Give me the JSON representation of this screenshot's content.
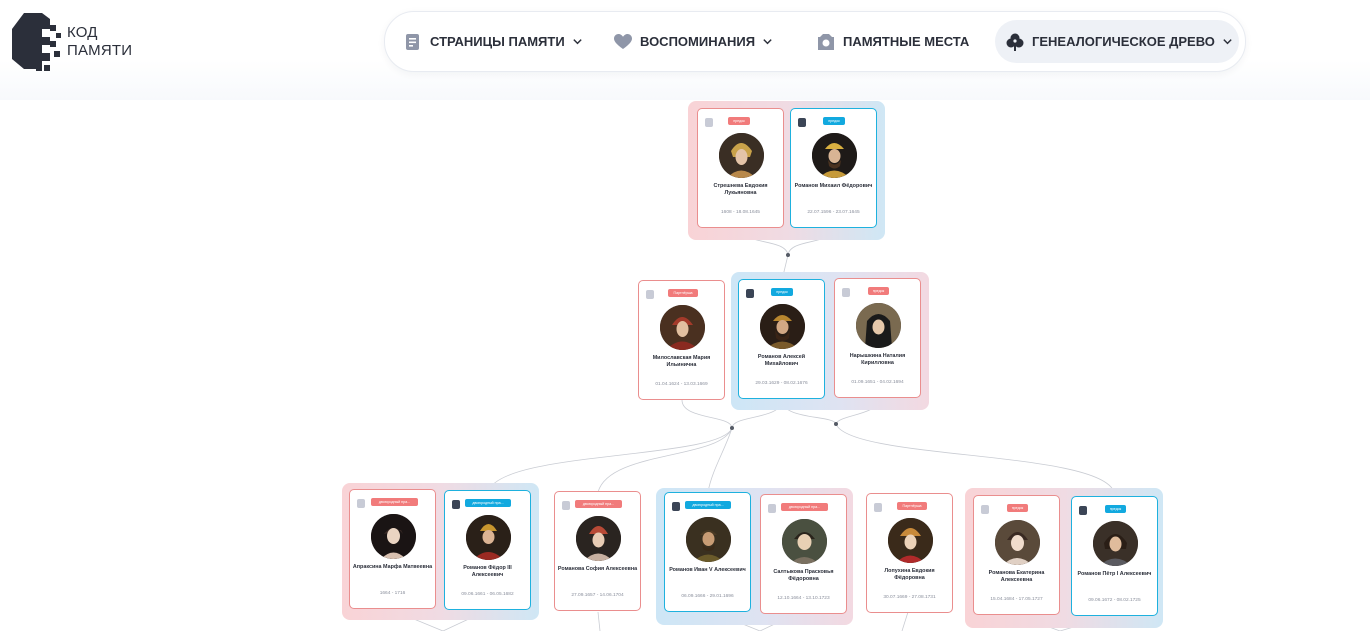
{
  "header": {
    "logo_line1": "КОД",
    "logo_line2": "ПАМЯТИ",
    "nav": [
      {
        "label": "СТРАНИЦЫ ПАМЯТИ",
        "icon": "document-icon",
        "dropdown": true
      },
      {
        "label": "ВОСПОМИНАНИЯ",
        "icon": "heart-icon",
        "dropdown": true
      },
      {
        "label": "ПАМЯТНЫЕ МЕСТА",
        "icon": "camera-icon",
        "dropdown": false
      },
      {
        "label": "ГЕНЕАЛОГИЧЕСКОЕ ДРЕВО",
        "icon": "tree-icon",
        "dropdown": true,
        "active": true
      }
    ]
  },
  "colors": {
    "female_border": "#ea8e8e",
    "male_border": "#1eb1de",
    "female_tag": "#f17b7b",
    "male_tag": "#12a9df"
  },
  "people": {
    "streshneva": {
      "tag": "предок",
      "name": "Стрешнева Евдокия Лукьяновна",
      "dates": "1608 - 18.08.1645"
    },
    "mikhail": {
      "tag": "предок",
      "name": "Романов Михаил Фёдорович",
      "dates": "22.07.1596 - 23.07.1645"
    },
    "miloslavskaya": {
      "tag": "Партнёрша",
      "name": "Милославская Мария Ильинична",
      "dates": "01.04.1624 - 13.03.1669"
    },
    "aleksey": {
      "tag": "предок",
      "name": "Романов Алексей Михайлович",
      "dates": "29.03.1629 - 08.02.1676"
    },
    "naryshkina": {
      "tag": "предок",
      "name": "Нарышкина Наталия Кирилловна",
      "dates": "01.09.1651 - 04.02.1694"
    },
    "apraksina": {
      "tag": "двоюродный пра...",
      "name": "Апраксина Марфа Матвеевна",
      "dates": "1664 - 1716"
    },
    "fedor": {
      "tag": "двоюродный пра...",
      "name": "Романов Фёдор III Алексеевич",
      "dates": "09.06.1661 - 06.05.1682"
    },
    "sofia": {
      "tag": "двоюродный пра...",
      "name": "Романова София Алексеевна",
      "dates": "27.09.1657 - 14.06.1704"
    },
    "ivan": {
      "tag": "двоюродный пра...",
      "name": "Романов Иван V Алексеевич",
      "dates": "06.09.1666 - 29.01.1696"
    },
    "saltykova": {
      "tag": "двоюродный пра...",
      "name": "Салтыкова Прасковья Фёдоровна",
      "dates": "12.10.1664 - 13.10.1723"
    },
    "lopukhina": {
      "tag": "Партнёрша",
      "name": "Лопухина Евдокия Фёдоровна",
      "dates": "30.07.1669 - 27.08.1731"
    },
    "ekaterina": {
      "tag": "предок",
      "name": "Романова Екатерина Алексеевна",
      "dates": "15.04.1684 - 17.05.1727"
    },
    "petr": {
      "tag": "предок",
      "name": "Романов Пётр I Алексеевич",
      "dates": "09.06.1672 - 08.02.1725"
    }
  }
}
